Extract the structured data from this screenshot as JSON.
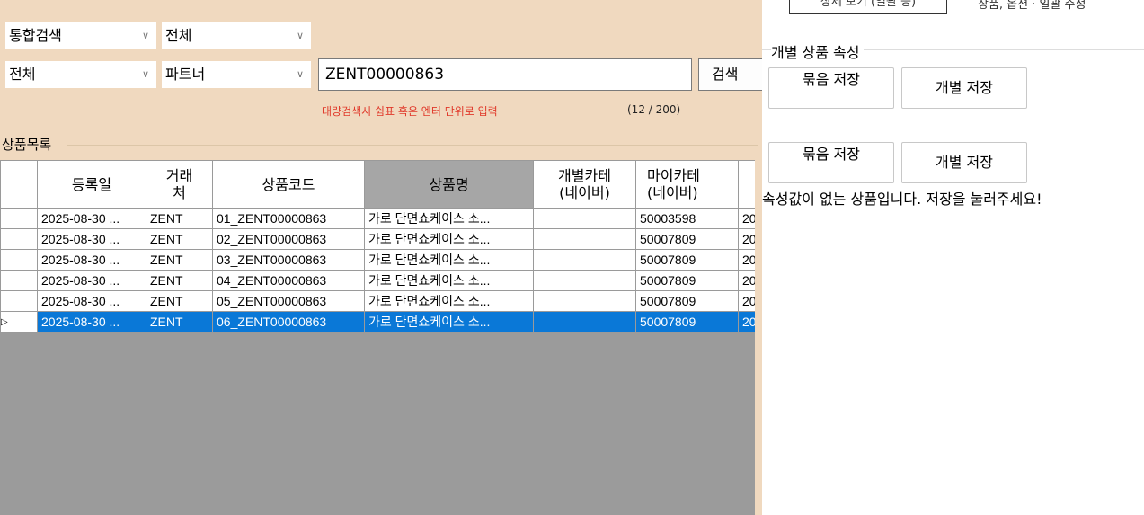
{
  "filters": {
    "search_type": "통합검색",
    "scope": "전체",
    "category": "전체",
    "partner": "파트너",
    "query": "ZENT00000863",
    "search_button": "검색",
    "hint": "대량검색시 쉼표 혹은 엔터 단위로 입력",
    "count": "(12 / 200)"
  },
  "list": {
    "title": "상품목록",
    "columns": [
      "등록일",
      "거래처",
      "상품코드",
      "상품명",
      "개별카테(네이버)",
      "마이카테(네이버)"
    ],
    "column_display": {
      "reg_date": "등록일",
      "vendor": [
        "거래",
        "처"
      ],
      "code": "상품코드",
      "name": "상품명",
      "cat_naver": [
        "개별카테",
        "(네이버)"
      ],
      "mycat_naver": [
        "마이카테",
        "(네이버)"
      ]
    },
    "rows": [
      {
        "date": "2025-08-30 ...",
        "vendor": "ZENT",
        "code": "01_ZENT00000863",
        "name": "가로 단면쇼케이스 소...",
        "cat": "",
        "mycat": "50003598",
        "extra": "20"
      },
      {
        "date": "2025-08-30 ...",
        "vendor": "ZENT",
        "code": "02_ZENT00000863",
        "name": "가로 단면쇼케이스 소...",
        "cat": "",
        "mycat": "50007809",
        "extra": "20"
      },
      {
        "date": "2025-08-30 ...",
        "vendor": "ZENT",
        "code": "03_ZENT00000863",
        "name": "가로 단면쇼케이스 소...",
        "cat": "",
        "mycat": "50007809",
        "extra": "20"
      },
      {
        "date": "2025-08-30 ...",
        "vendor": "ZENT",
        "code": "04_ZENT00000863",
        "name": "가로 단면쇼케이스 소...",
        "cat": "",
        "mycat": "50007809",
        "extra": "20"
      },
      {
        "date": "2025-08-30 ...",
        "vendor": "ZENT",
        "code": "05_ZENT00000863",
        "name": "가로 단면쇼케이스 소...",
        "cat": "",
        "mycat": "50007809",
        "extra": "20"
      },
      {
        "date": "2025-08-30 ...",
        "vendor": "ZENT",
        "code": "06_ZENT00000863",
        "name": "가로 단면쇼케이스 소...",
        "cat": "",
        "mycat": "50007809",
        "extra": "20"
      }
    ],
    "selected_row_indicator": "▷"
  },
  "right": {
    "top_button": "상세 보기 (일괄 등)",
    "top_text": "상품, 옵션 · 일괄 수정",
    "group_title": "개별 상품 속성",
    "bundle_save": "묶음 저장",
    "individual_save": "개별 저장",
    "notice": "속성값이 없는 상품입니다. 저장을 눌러주세요!"
  },
  "colors": {
    "panel_bg": "#f0d9bf",
    "selection": "#0a78d7",
    "hint_red": "#e0392a"
  }
}
